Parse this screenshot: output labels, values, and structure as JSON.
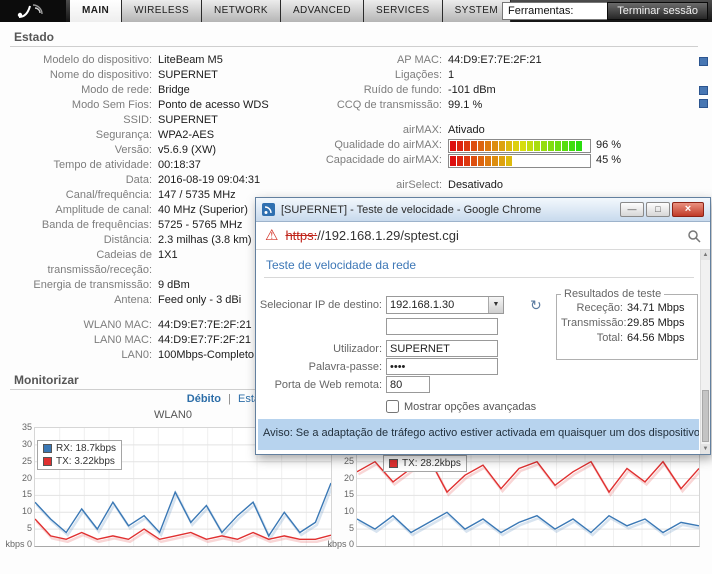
{
  "colors": {
    "accent_blue": "#3d77b6",
    "link_blue": "#2d6ea8",
    "rx_blue": "#3a78b5",
    "tx_red": "#e03030"
  },
  "header": {
    "tabs": [
      {
        "label": "MAIN",
        "active": true
      },
      {
        "label": "WIRELESS",
        "active": false
      },
      {
        "label": "NETWORK",
        "active": false
      },
      {
        "label": "ADVANCED",
        "active": false
      },
      {
        "label": "SERVICES",
        "active": false
      },
      {
        "label": "SYSTEM",
        "active": false
      }
    ],
    "tools_select_value": "Ferramentas:",
    "logout_button": "Terminar sessão"
  },
  "status": {
    "title": "Estado",
    "left_rows": [
      {
        "label": "Modelo do dispositivo:",
        "value": "LiteBeam M5"
      },
      {
        "label": "Nome do dispositivo:",
        "value": "SUPERNET"
      },
      {
        "label": "Modo de rede:",
        "value": "Bridge"
      },
      {
        "label": "Modo Sem Fios:",
        "value": "Ponto de acesso WDS"
      },
      {
        "label": "SSID:",
        "value": "SUPERNET"
      },
      {
        "label": "Segurança:",
        "value": "WPA2-AES"
      },
      {
        "label": "Versão:",
        "value": "v5.6.9 (XW)"
      },
      {
        "label": "Tempo de atividade:",
        "value": "00:18:37"
      },
      {
        "label": "Data:",
        "value": "2016-08-19 09:04:31"
      },
      {
        "label": "Canal/frequência:",
        "value": "147 / 5735 MHz"
      },
      {
        "label": "Amplitude de canal:",
        "value": "40 MHz (Superior)"
      },
      {
        "label": "Banda de frequências:",
        "value": "5725 - 5765 MHz"
      },
      {
        "label": "Distância:",
        "value": "2.3 milhas (3.8 km)"
      },
      {
        "label": "Cadeias de transmissão/receção:",
        "value": "1X1"
      },
      {
        "label": "Energia de transmissão:",
        "value": "9 dBm"
      },
      {
        "label": "Antena:",
        "value": "Feed only - 3 dBi"
      },
      {
        "label": "WLAN0 MAC:",
        "value": "44:D9:E7:7E:2F:21",
        "gap": true
      },
      {
        "label": "LAN0 MAC:",
        "value": "44:D9:E7:7F:2F:21"
      },
      {
        "label": "LAN0:",
        "value": "100Mbps-Completo"
      }
    ],
    "right_rows": [
      {
        "label": "AP MAC:",
        "value": "44:D9:E7:7E:2F:21"
      },
      {
        "label": "Ligações:",
        "value": "1"
      },
      {
        "label": "Ruído de fundo:",
        "value": "-101 dBm"
      },
      {
        "label": "CCQ de transmissão:",
        "value": "99.1 %"
      },
      {
        "label": "airMAX:",
        "value": "Ativado",
        "gap": true
      },
      {
        "label": "Qualidade do airMAX:",
        "value": "96 %",
        "bar": 96
      },
      {
        "label": "Capacidade do airMAX:",
        "value": "45 %",
        "bar": 45
      },
      {
        "label": "airSelect:",
        "value": "Desativado",
        "gap": true
      }
    ]
  },
  "monitor": {
    "title": "Monitorizar",
    "throughput_link": "Débito",
    "separator": "|",
    "stations_link": "Estações",
    "chart1_title": "WLAN0"
  },
  "chart_data": [
    {
      "type": "line",
      "title": "WLAN0",
      "ylabel": "kbps",
      "ylim": [
        0,
        35
      ],
      "ytick_step": 5,
      "grid": true,
      "legend_position": "top-left",
      "legend_offset": [
        2,
        12
      ],
      "series": [
        {
          "name": "RX",
          "legend": "RX: 18.7kbps",
          "color": "#3a78b5",
          "values": [
            13,
            8,
            4,
            11,
            5,
            13,
            6,
            9,
            4,
            16,
            7,
            12,
            4,
            9,
            13,
            3,
            10,
            4,
            7,
            18.7
          ]
        },
        {
          "name": "TX",
          "legend": "TX: 3.22kbps",
          "color": "#e03030",
          "values": [
            8,
            3,
            2,
            4,
            2,
            3,
            2,
            5,
            2,
            3,
            4,
            2,
            3,
            2,
            4,
            2,
            3,
            2,
            2,
            3.2
          ]
        }
      ]
    },
    {
      "type": "line",
      "title": "",
      "ylabel": "kbps",
      "ylim": [
        0,
        35
      ],
      "ytick_step": 5,
      "grid": true,
      "legend_position": "top-left",
      "legend_offset": [
        26,
        27
      ],
      "series": [
        {
          "name": "RX",
          "legend": null,
          "color": "#3a78b5",
          "values": [
            8,
            5,
            9,
            4,
            7,
            10,
            5,
            8,
            4,
            7,
            9,
            5,
            8,
            4,
            9,
            6,
            8,
            4,
            7,
            6
          ]
        },
        {
          "name": "TX",
          "legend": "TX: 28.2kbps",
          "color": "#e03030",
          "values": [
            22,
            25,
            19,
            23,
            26,
            16,
            21,
            24,
            17,
            23,
            25,
            18,
            22,
            25,
            16,
            23,
            19,
            25,
            17,
            23
          ]
        }
      ]
    }
  ],
  "popup": {
    "title": "[SUPERNET] - Teste de velocidade - Google Chrome",
    "url_scheme": "https:",
    "url_rest": "//192.168.1.29/sptest.cgi",
    "heading": "Teste de velocidade da rede",
    "form": {
      "ip_label": "Selecionar IP de destino:",
      "ip_value": "192.168.1.30",
      "custom_ip_value": "",
      "user_label": "Utilizador:",
      "user_value": "SUPERNET",
      "pass_label": "Palavra-passe:",
      "pass_value": "••••",
      "port_label": "Porta de Web remota:",
      "port_value": "80",
      "advanced_label": "Mostrar opções avançadas"
    },
    "results": {
      "legend": "Resultados de teste",
      "rows": [
        {
          "label": "Receção:",
          "value": "34.71 Mbps"
        },
        {
          "label": "Transmissão:",
          "value": "29.85 Mbps"
        },
        {
          "label": "Total:",
          "value": "64.56 Mbps"
        }
      ]
    },
    "warning_text": "Aviso: Se a adaptação de tráfego activo estiver activada em quaisquer um dos dispositivos, os resulta"
  },
  "icons": {
    "dropdown_arrow": "▼",
    "refresh": "↻",
    "warning": "⚠",
    "minimize": "—",
    "maximize": "□",
    "close": "×",
    "arrow_up": "▲",
    "arrow_down": "▼"
  }
}
